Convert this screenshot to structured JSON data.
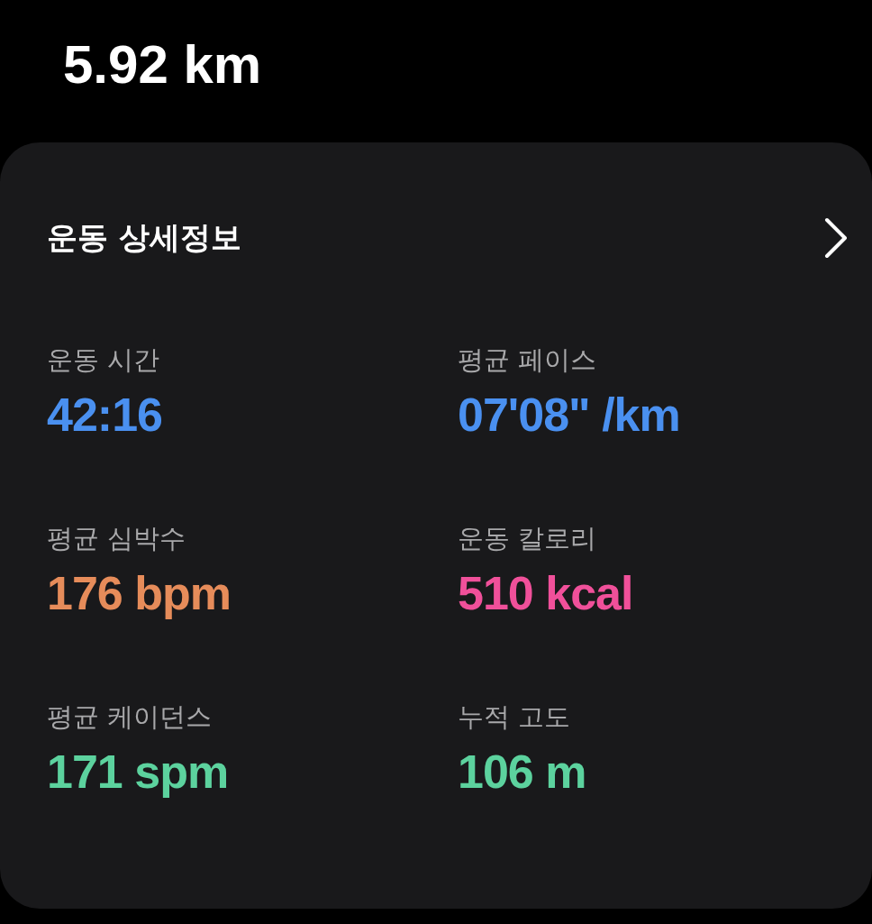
{
  "distance": "5.92 km",
  "card": {
    "title": "운동 상세정보",
    "metrics": [
      {
        "label": "운동 시간",
        "value": "42:16",
        "color": "#4a90f0"
      },
      {
        "label": "평균 페이스",
        "value": "07'08\" /km",
        "color": "#4a90f0"
      },
      {
        "label": "평균 심박수",
        "value": "176 bpm",
        "color": "#e68c5a"
      },
      {
        "label": "운동 칼로리",
        "value": "510 kcal",
        "color": "#f0509a"
      },
      {
        "label": "평균 케이던스",
        "value": "171 spm",
        "color": "#5cd29e"
      },
      {
        "label": "누적 고도",
        "value": "106 m",
        "color": "#5cd29e"
      }
    ]
  }
}
